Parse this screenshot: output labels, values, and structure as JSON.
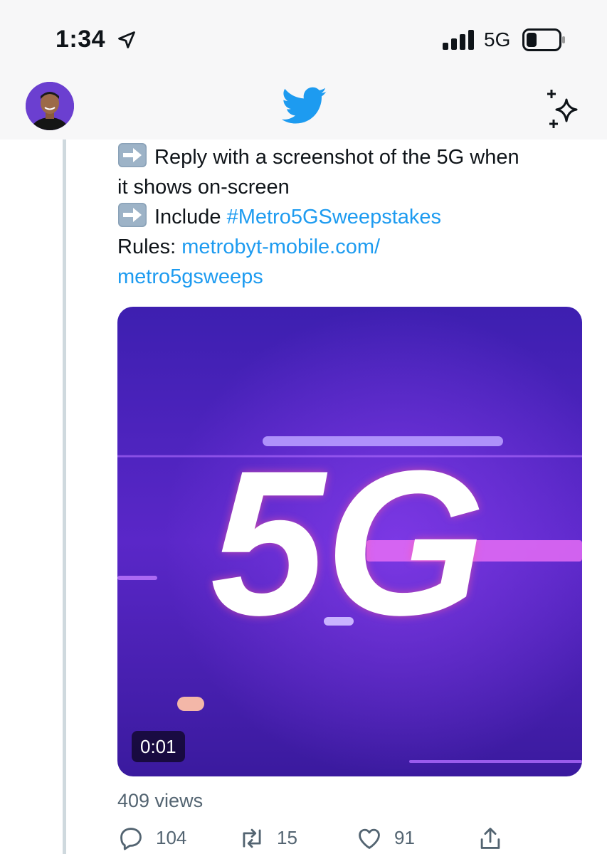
{
  "status_bar": {
    "time": "1:34",
    "network": "5G",
    "icons": [
      "location-arrow-icon",
      "signal-bars-icon",
      "battery-icon"
    ]
  },
  "header": {
    "logo": "twitter-bird-icon",
    "sparkle": "sparkle-icon",
    "brand_color": "#1d9bf0"
  },
  "tweet": {
    "line1": "Reply with a screenshot of the 5G when",
    "line2": "it shows on-screen",
    "line3_prefix": "Include ",
    "hashtag": "#Metro5GSweepstakes",
    "rules_label": "Rules: ",
    "rules_link_part1": "metrobyt-mobile.com/",
    "rules_link_part2": "metro5gsweeps",
    "bullet_icon": "right-arrow-emoji-icon"
  },
  "media": {
    "headline": "5G",
    "duration": "0:01",
    "background_color": "#4a1fae"
  },
  "stats": {
    "views": "409 views",
    "replies": "104",
    "retweets": "15",
    "likes": "91"
  },
  "colors": {
    "text": "#0f1419",
    "secondary": "#536471",
    "link": "#1d9bf0"
  }
}
